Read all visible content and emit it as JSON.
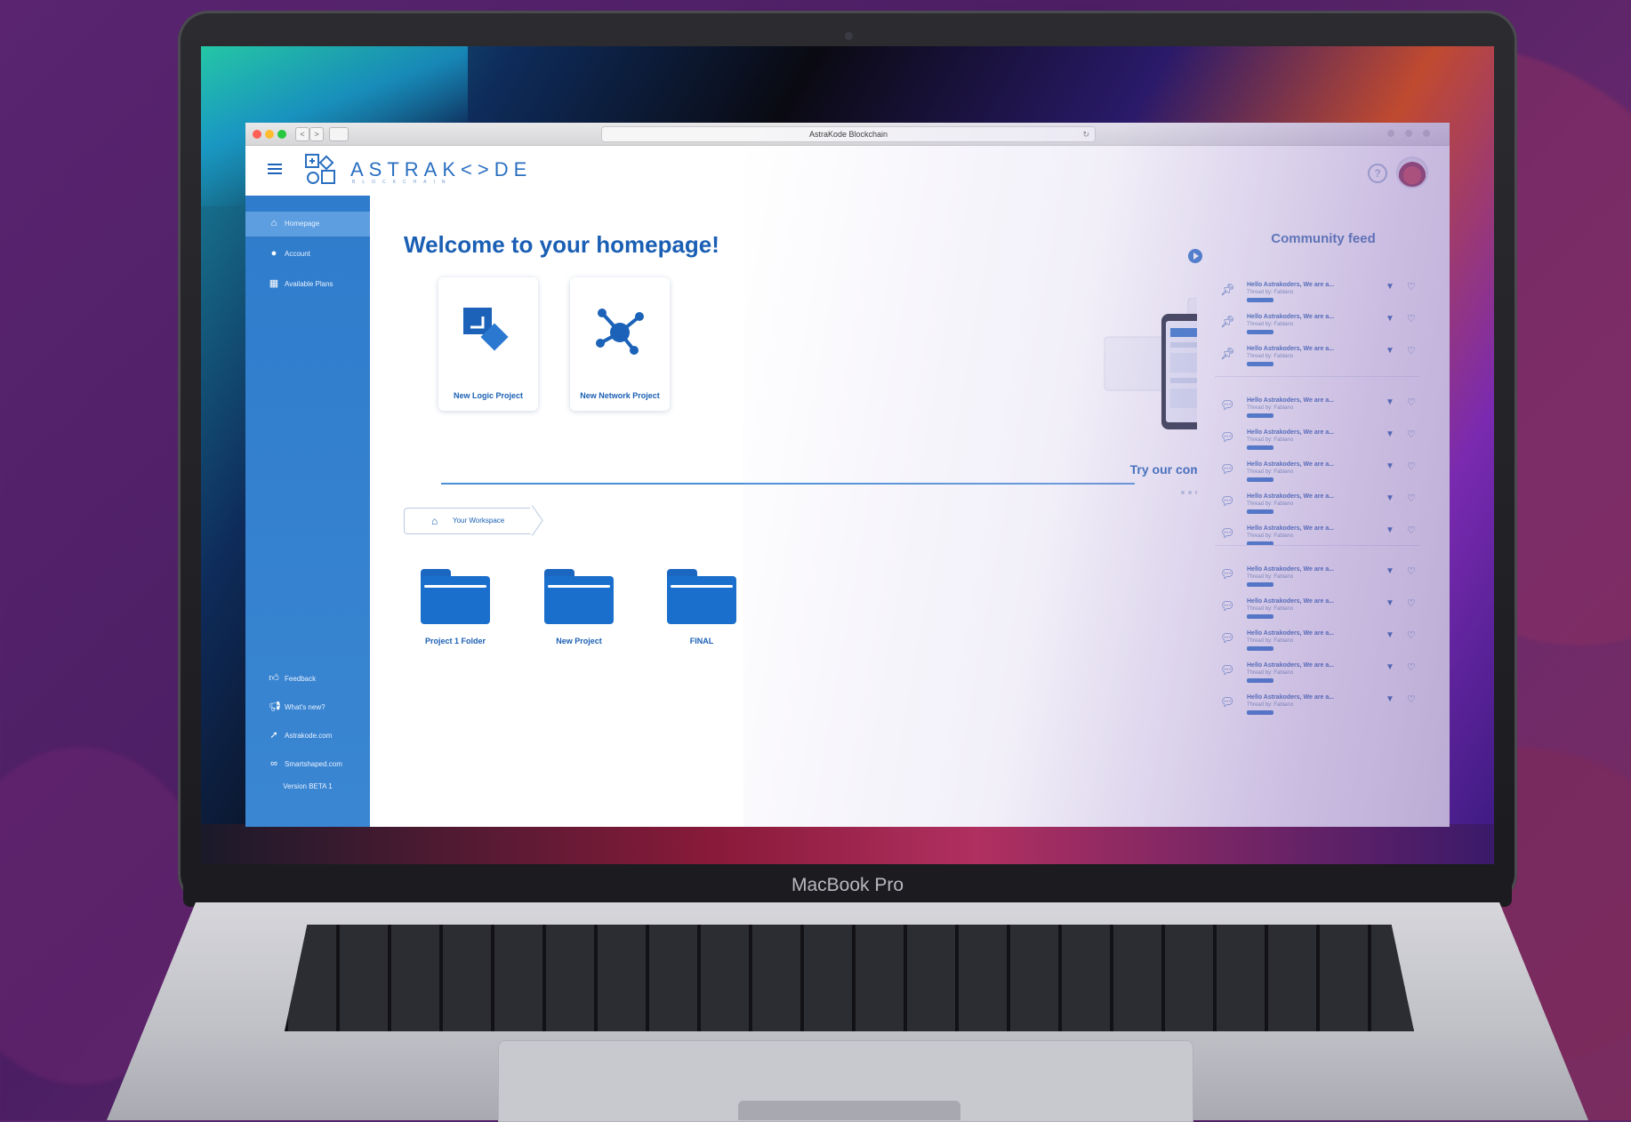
{
  "device": {
    "brand": "MacBook Pro"
  },
  "browser": {
    "url_title": "AstraKode Blockchain",
    "back": "<",
    "forward": ">"
  },
  "header": {
    "logo_text": "ASTRAK<>DE",
    "logo_sub": "BLOCKCHAIN",
    "help": "?"
  },
  "sidebar": {
    "items": [
      {
        "label": "Homepage",
        "icon": "home-icon"
      },
      {
        "label": "Account",
        "icon": "user-icon"
      },
      {
        "label": "Available Plans",
        "icon": "grid-icon"
      }
    ],
    "bottom_items": [
      {
        "label": "Feedback",
        "icon": "thumbs-up-icon"
      },
      {
        "label": "What's new?",
        "icon": "megaphone-icon"
      },
      {
        "label": "Astrakode.com",
        "icon": "rocket-icon"
      },
      {
        "label": "Smartshaped.com",
        "icon": "infinity-icon"
      }
    ],
    "version": "Version BETA 1"
  },
  "main": {
    "welcome": "Welcome to your homepage!",
    "cards": [
      {
        "label": "New Logic Project"
      },
      {
        "label": "New Network Project"
      }
    ],
    "community_cta": "Try our community!",
    "breadcrumb": "Your Workspace",
    "folders": [
      {
        "name": "Project 1 Folder"
      },
      {
        "name": "New Project"
      },
      {
        "name": "FINAL"
      }
    ]
  },
  "feed": {
    "title": "Community feed",
    "post_title": "Hello Astrakoders, We are a...",
    "post_meta": "Thread by: Fabiano",
    "rows": [
      {
        "icon": "pin-icon",
        "group": 1
      },
      {
        "icon": "pin-icon",
        "group": 1
      },
      {
        "icon": "pin-icon",
        "group": 1
      },
      {
        "icon": "chat-icon",
        "group": 2
      },
      {
        "icon": "chat-icon",
        "group": 2
      },
      {
        "icon": "chat-icon",
        "group": 2
      },
      {
        "icon": "chat-icon",
        "group": 2
      },
      {
        "icon": "chat-icon",
        "group": 2
      },
      {
        "icon": "chat-icon",
        "group": 3
      },
      {
        "icon": "chat-icon",
        "group": 3
      },
      {
        "icon": "chat-icon",
        "group": 3
      },
      {
        "icon": "chat-icon",
        "group": 3
      },
      {
        "icon": "chat-icon",
        "group": 3
      }
    ]
  },
  "colors": {
    "primary": "#1a5fb4",
    "sidebar": "#2f7ccc",
    "accent": "#2a73c8"
  }
}
